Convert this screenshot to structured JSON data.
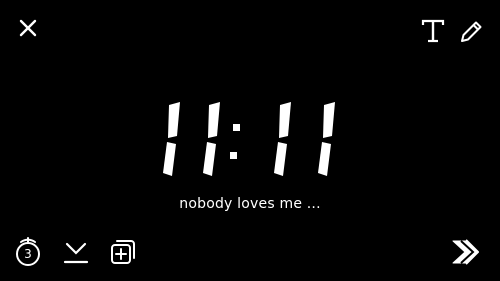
{
  "clock": {
    "hour": "11",
    "minute": "11",
    "separator": ":"
  },
  "caption": "nobody loves me ...",
  "timer": {
    "value": "3"
  },
  "icons": {
    "close": "close-icon",
    "text": "text-tool-icon",
    "pencil": "pencil-icon",
    "timer": "timer-icon",
    "save": "download-icon",
    "story": "add-to-story-icon",
    "send": "send-arrow-icon"
  },
  "colors": {
    "background": "#000000",
    "foreground": "#ffffff"
  }
}
